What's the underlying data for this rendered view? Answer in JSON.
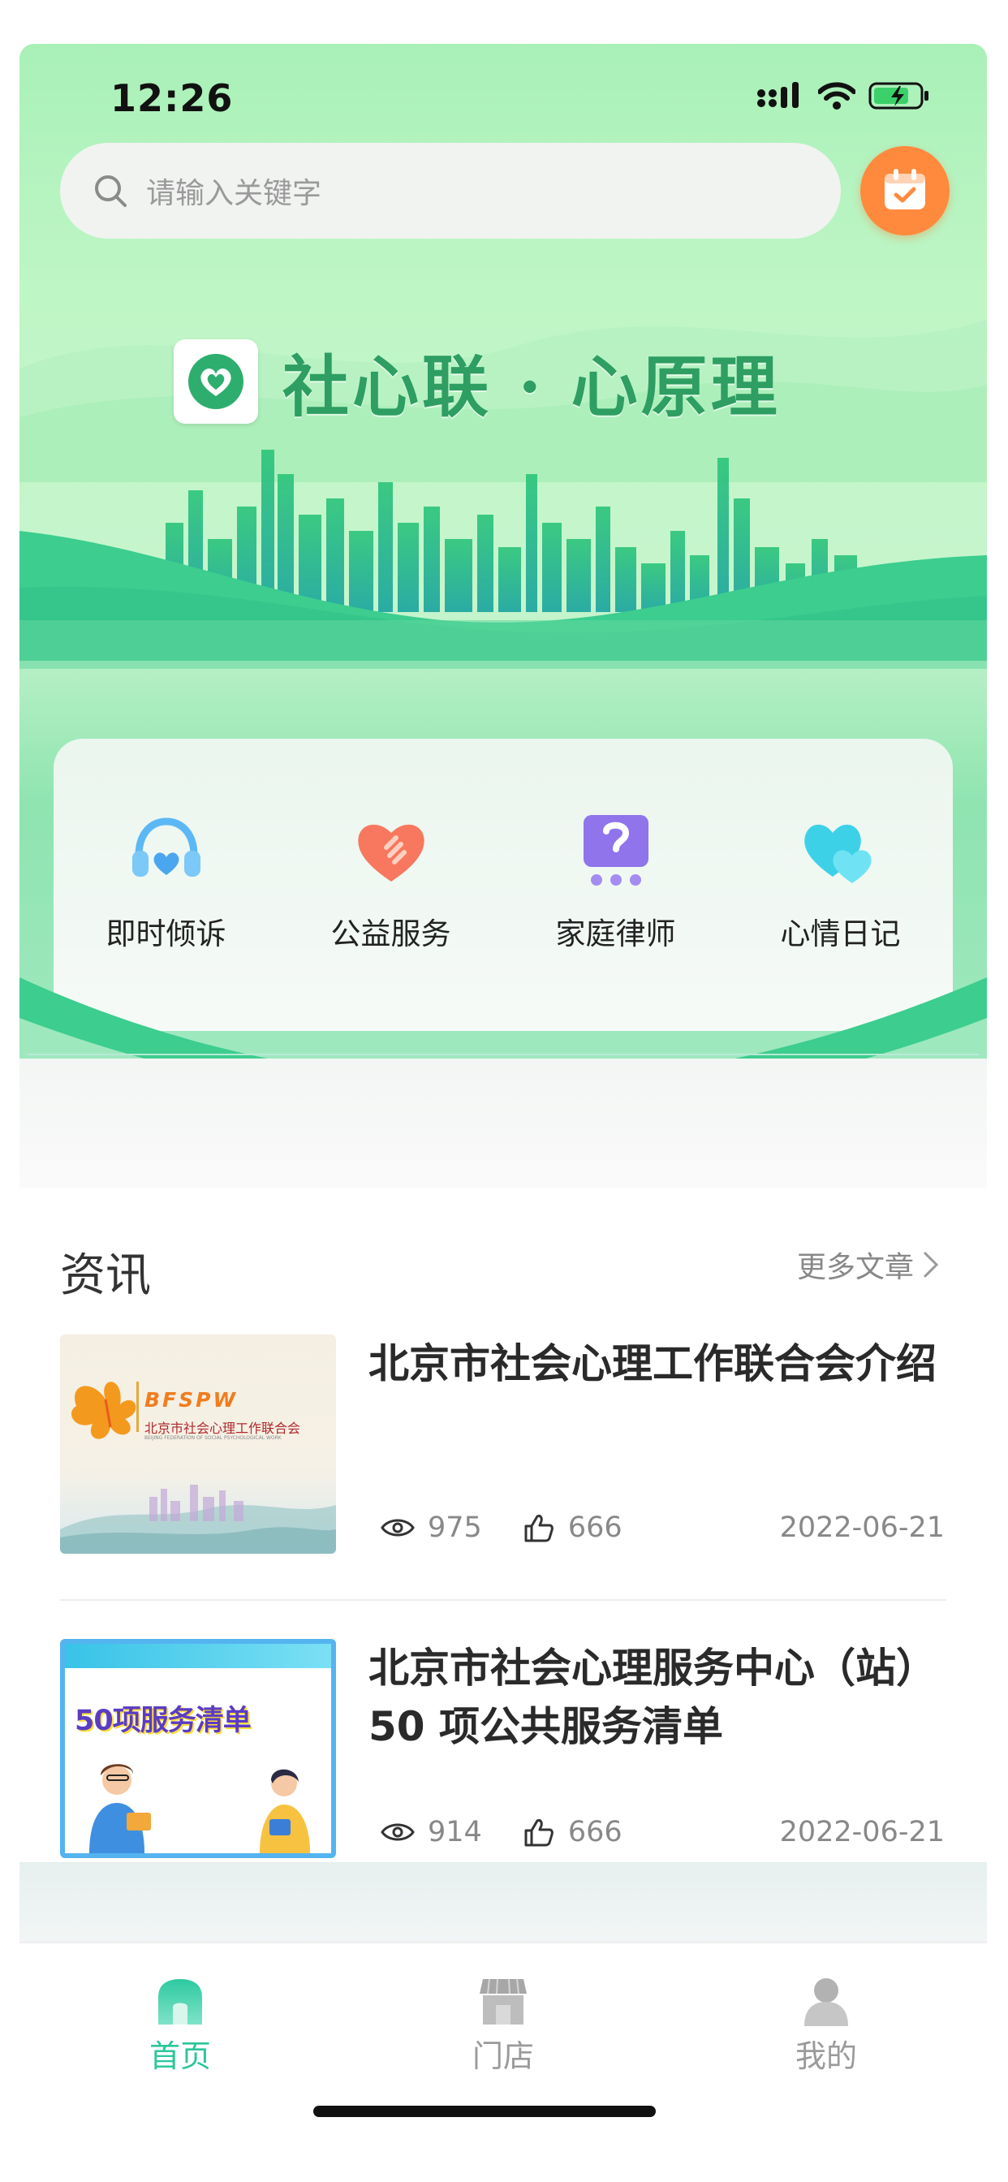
{
  "status_bar": {
    "time": "12:26"
  },
  "search": {
    "placeholder": "请输入关键字"
  },
  "brand": {
    "title": "社心联 · 心原理"
  },
  "menu": [
    {
      "label": "即时倾诉",
      "icon": "headphones-heart-icon"
    },
    {
      "label": "公益服务",
      "icon": "hand-heart-icon"
    },
    {
      "label": "家庭律师",
      "icon": "lawyer-chat-icon"
    },
    {
      "label": "心情日记",
      "icon": "hearts-icon"
    }
  ],
  "news": {
    "title": "资讯",
    "more_label": "更多文章",
    "articles": [
      {
        "title": "北京市社会心理工作联合会介绍",
        "views": "975",
        "likes": "666",
        "date": "2022-06-21",
        "thumb_brand": "BFSPW",
        "thumb_org": "北京市社会心理工作联合会",
        "thumb_org_en": "BEIJING FEDERATION OF SOCIAL PSYCHOLOGICAL WORK"
      },
      {
        "title": "北京市社会心理服务中心（站）50 项公共服务清单",
        "views": "914",
        "likes": "666",
        "date": "2022-06-21",
        "thumb_text": "50项服务清单"
      }
    ]
  },
  "tabs": [
    {
      "label": "首页",
      "icon": "home-icon",
      "active": true
    },
    {
      "label": "门店",
      "icon": "store-icon",
      "active": false
    },
    {
      "label": "我的",
      "icon": "user-icon",
      "active": false
    }
  ],
  "colors": {
    "accent": "#2cc69a",
    "hero_green": "#a9f0b8",
    "brand_green": "#2e9e62",
    "calendar_orange": "#ff8a3d"
  }
}
